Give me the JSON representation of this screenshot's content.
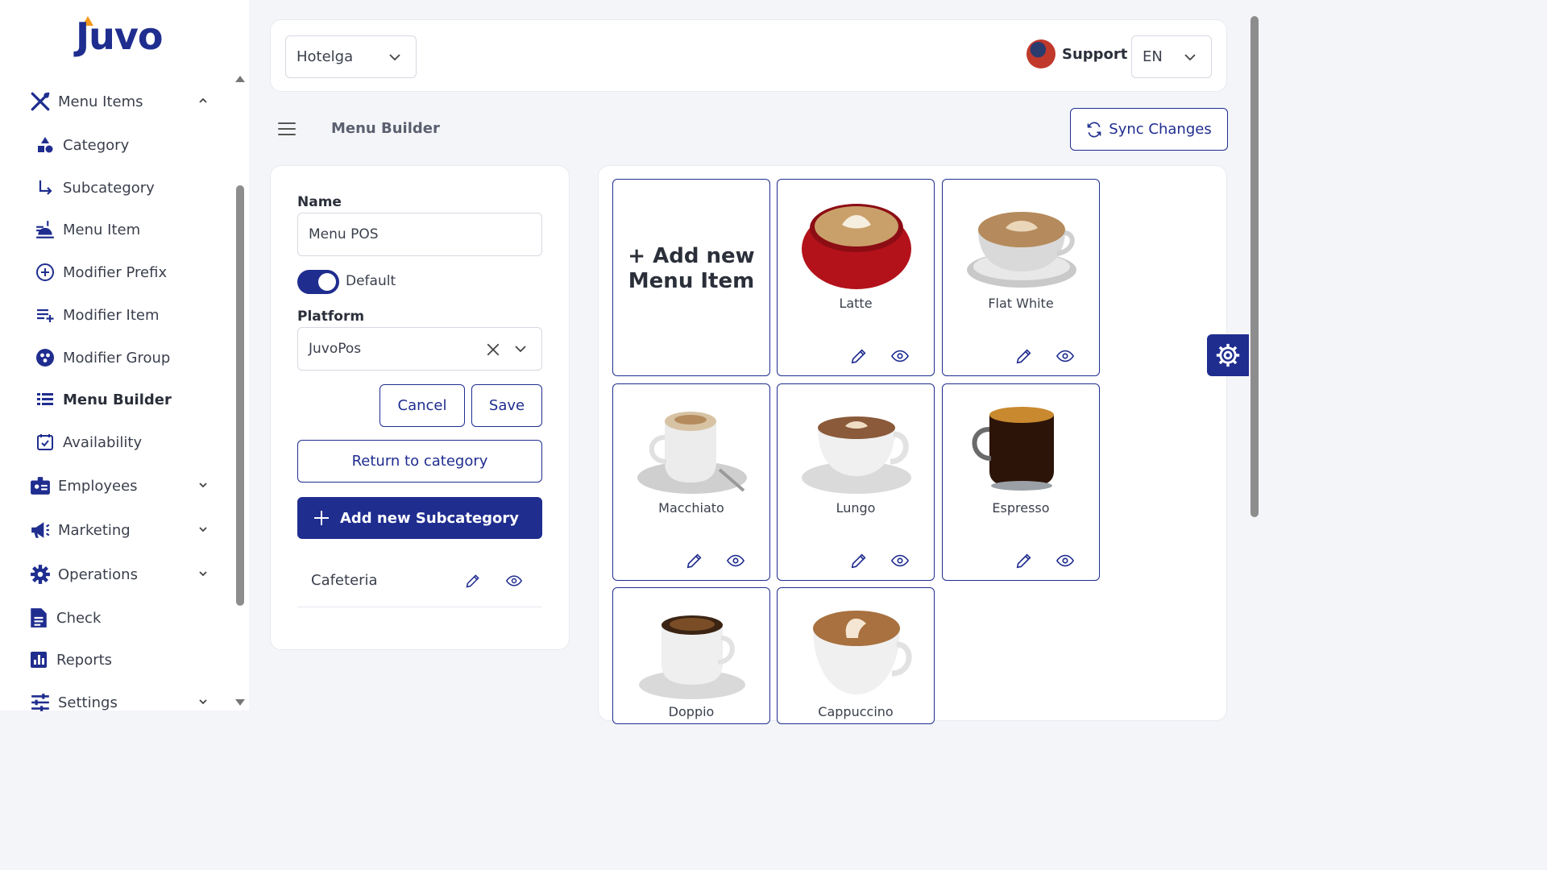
{
  "brand": {
    "logo_text": "Juvo",
    "accent": "#1f2d8f",
    "logo_accent": "#f39a1c"
  },
  "sidebar": {
    "items": [
      {
        "label": "Menu Items",
        "icon": "utensils-icon",
        "expanded": true
      },
      {
        "label": "Category",
        "icon": "shapes-icon"
      },
      {
        "label": "Subcategory",
        "icon": "arrow-turn-right-icon"
      },
      {
        "label": "Menu Item",
        "icon": "bell-food-icon"
      },
      {
        "label": "Modifier Prefix",
        "icon": "plus-circle-icon"
      },
      {
        "label": "Modifier Item",
        "icon": "list-plus-icon"
      },
      {
        "label": "Modifier Group",
        "icon": "group-circle-icon"
      },
      {
        "label": "Menu Builder",
        "icon": "list-icon",
        "active": true
      },
      {
        "label": "Availability",
        "icon": "calendar-check-icon"
      },
      {
        "label": "Employees",
        "icon": "id-badge-icon"
      },
      {
        "label": "Marketing",
        "icon": "megaphone-icon"
      },
      {
        "label": "Operations",
        "icon": "gear-icon"
      },
      {
        "label": "Check",
        "icon": "document-icon"
      },
      {
        "label": "Reports",
        "icon": "bar-chart-icon"
      },
      {
        "label": "Settings",
        "icon": "sliders-icon"
      }
    ]
  },
  "topbar": {
    "location_select": "Hotelga",
    "support_label": "Support",
    "language_select": "EN"
  },
  "toolbar": {
    "page_title": "Menu Builder",
    "sync_label": "Sync Changes"
  },
  "form": {
    "name_label": "Name",
    "name_value": "Menu POS",
    "default_label": "Default",
    "default_on": true,
    "platform_label": "Platform",
    "platform_value": "JuvoPos",
    "cancel_label": "Cancel",
    "save_label": "Save",
    "return_label": "Return to category",
    "add_subcategory_label": "Add new Subcategory",
    "subcategories": [
      {
        "label": "Cafeteria"
      }
    ]
  },
  "grid": {
    "add_label_line1": "+ Add new",
    "add_label_line2": "Menu Item",
    "items": [
      {
        "name": "Latte"
      },
      {
        "name": "Flat White"
      },
      {
        "name": "Macchiato"
      },
      {
        "name": "Lungo"
      },
      {
        "name": "Espresso"
      },
      {
        "name": "Doppio"
      },
      {
        "name": "Cappuccino"
      }
    ]
  }
}
